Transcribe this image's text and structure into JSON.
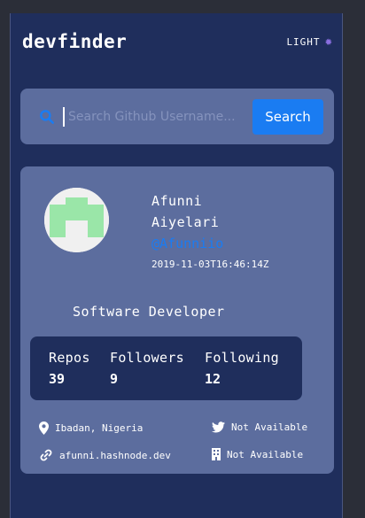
{
  "header": {
    "logo": "devfinder",
    "theme_label": "LIGHT"
  },
  "search": {
    "placeholder": "Search Github Username...",
    "value": "",
    "button_label": "Search"
  },
  "profile": {
    "first_name": "Afunni",
    "last_name": "Aiyelari",
    "login": "@Afunniio",
    "joined": "2019-11-03T16:46:14Z",
    "bio": "Software Developer",
    "stats": {
      "repos_label": "Repos",
      "repos": "39",
      "followers_label": "Followers",
      "followers": "9",
      "following_label": "Following",
      "following": "12"
    },
    "location": "Ibadan, Nigeria",
    "twitter": "Not Available",
    "website": "afunni.hashnode.dev",
    "company": "Not Available"
  },
  "colors": {
    "background": "#1f2e5c",
    "card": "#5c6d9e",
    "accent": "#1a7cf2",
    "avatar_pattern": "#9ae6a8",
    "sun_icon": "#8b6fe0"
  },
  "icons": [
    "sun-icon",
    "search-icon",
    "location-pin-icon",
    "twitter-icon",
    "link-icon",
    "building-icon"
  ]
}
